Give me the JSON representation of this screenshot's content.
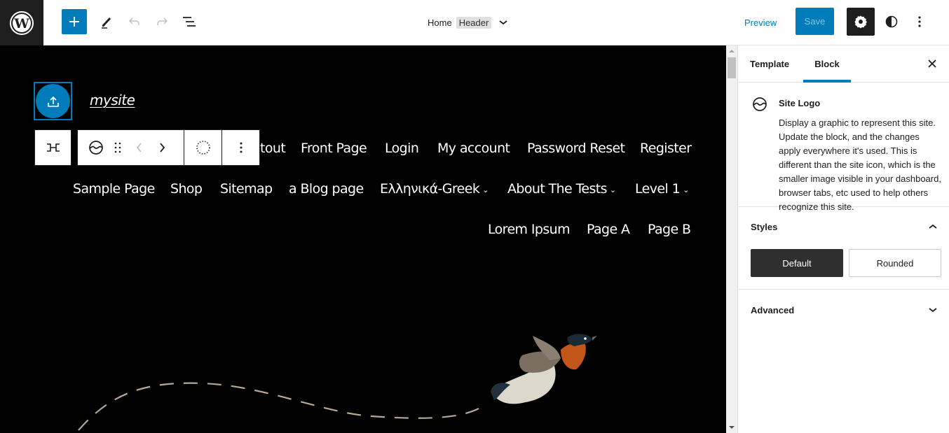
{
  "topbar": {
    "logo_icon": "wordpress-logo-icon",
    "inserter_label": "+",
    "tools": [
      "edit-icon",
      "undo-icon",
      "redo-icon",
      "list-view-icon"
    ],
    "doc_title": {
      "page": "Home",
      "template_part": "Header"
    },
    "preview_label": "Preview",
    "save_label": "Save",
    "settings_icon": "gear-icon",
    "styles_icon": "half-circle-icon",
    "options_icon": "vertical-ellipsis-icon"
  },
  "canvas": {
    "site_title": "mysite",
    "logo_placeholder_icon": "upload-icon",
    "block_toolbar": {
      "parent_icon": "select-parent-icon",
      "block_icon": "site-logo-icon",
      "drag_icon": "drag-handle-icon",
      "prev_icon": "chevron-left-icon",
      "next_icon": "chevron-right-icon",
      "circle_icon": "dotted-circle-icon",
      "more_icon": "vertical-ellipsis-icon"
    },
    "nav_rows": [
      [
        {
          "label": "tout",
          "has_submenu": false
        },
        {
          "label": "Front Page",
          "has_submenu": false
        },
        {
          "label": "Login",
          "has_submenu": false
        },
        {
          "label": "My account",
          "has_submenu": false
        },
        {
          "label": "Password Reset",
          "has_submenu": false
        },
        {
          "label": "Register",
          "has_submenu": false
        }
      ],
      [
        {
          "label": "Sample Page",
          "has_submenu": false
        },
        {
          "label": "Shop",
          "has_submenu": false
        },
        {
          "label": "Sitemap",
          "has_submenu": false
        },
        {
          "label": "a Blog page",
          "has_submenu": false
        },
        {
          "label": "Ελληνικά-Greek",
          "has_submenu": true
        },
        {
          "label": "About The Tests",
          "has_submenu": true
        },
        {
          "label": "Level 1",
          "has_submenu": true
        }
      ],
      [
        {
          "label": "Lorem Ipsum",
          "has_submenu": false
        },
        {
          "label": "Page A",
          "has_submenu": false
        },
        {
          "label": "Page B",
          "has_submenu": false
        }
      ]
    ],
    "decoration": "bird-illustration"
  },
  "sidebar": {
    "tabs": [
      {
        "label": "Template",
        "active": false
      },
      {
        "label": "Block",
        "active": true
      }
    ],
    "close_icon": "close-icon",
    "block": {
      "icon": "site-logo-icon",
      "title": "Site Logo",
      "description": "Display a graphic to represent this site. Update the block, and the changes apply everywhere it's used. This is different than the site icon, which is the smaller image visible in your dashboard, browser tabs, etc used to help others recognize this site."
    },
    "styles_panel": {
      "title": "Styles",
      "expanded": true,
      "options": [
        {
          "label": "Default",
          "active": true
        },
        {
          "label": "Rounded",
          "active": false
        }
      ]
    },
    "advanced_panel": {
      "title": "Advanced",
      "expanded": false
    }
  },
  "colors": {
    "accent": "#007cba",
    "dark": "#1e1e1e",
    "canvas_bg": "#000000"
  }
}
